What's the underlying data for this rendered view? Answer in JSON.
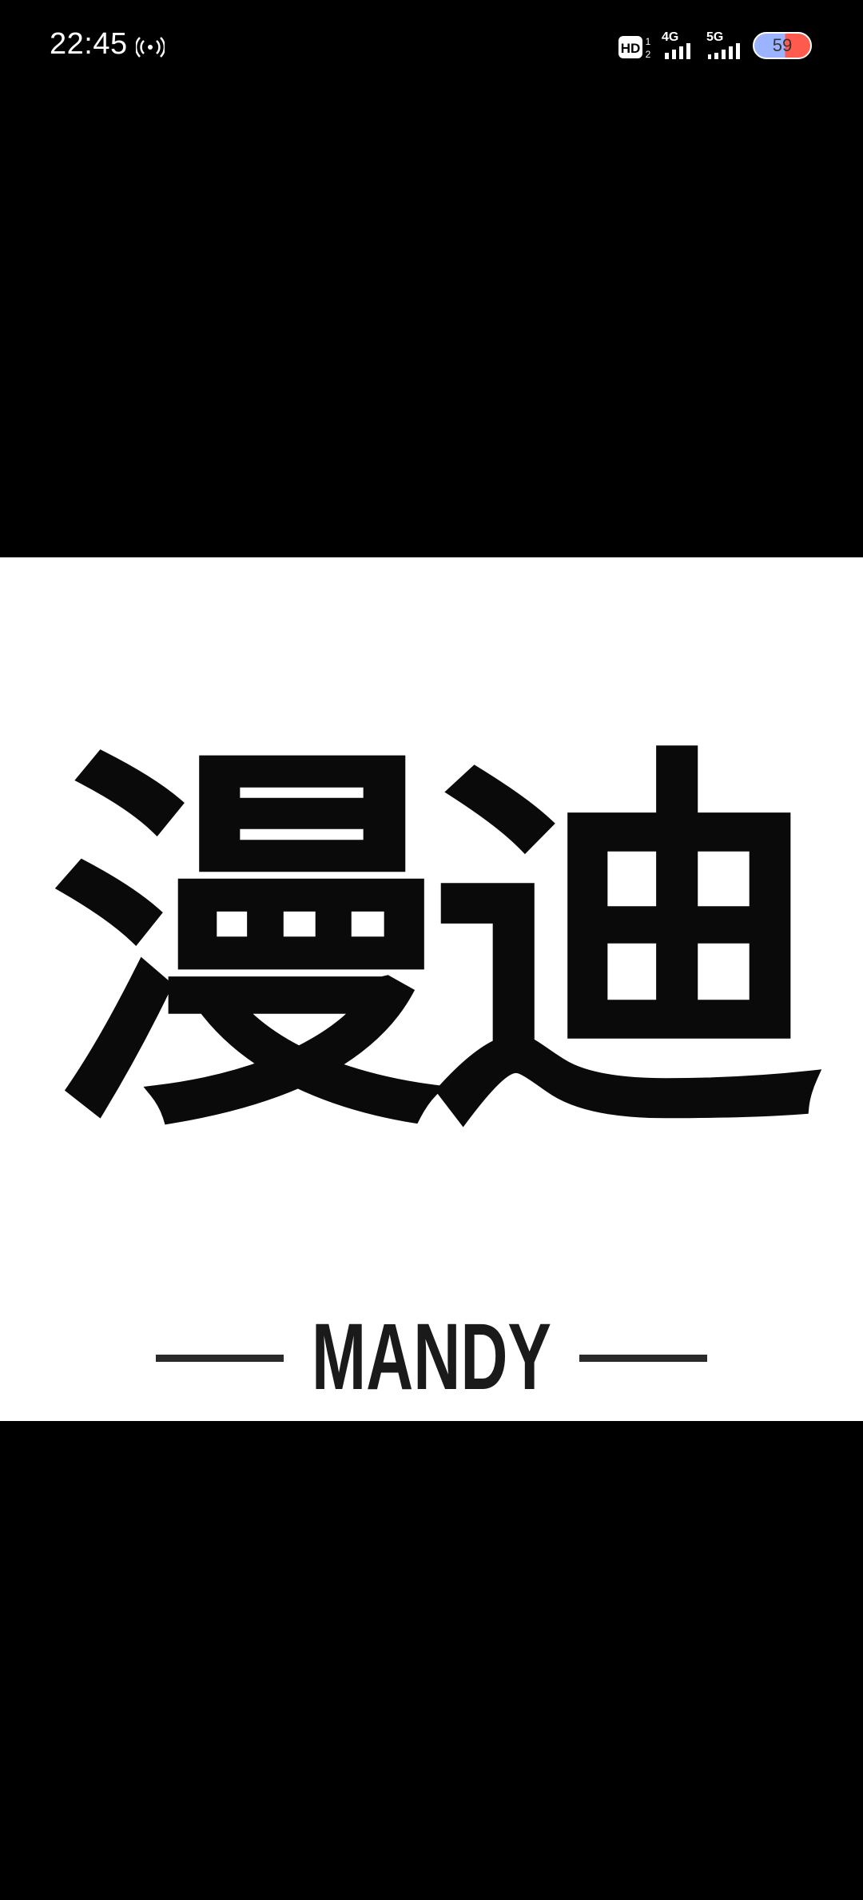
{
  "status_bar": {
    "time": "22:45",
    "battery_level": "59",
    "network_1": "4G",
    "network_2": "5G",
    "hd_label": "HD",
    "hotspot_icon": "hotspot-icon",
    "colors": {
      "battery_fill": "#9cb4ff",
      "battery_low": "#ff5a4e"
    }
  },
  "viewer": {
    "background": "#000000",
    "image": {
      "brand_cn": "漫迪",
      "brand_en": "MANDY"
    }
  }
}
